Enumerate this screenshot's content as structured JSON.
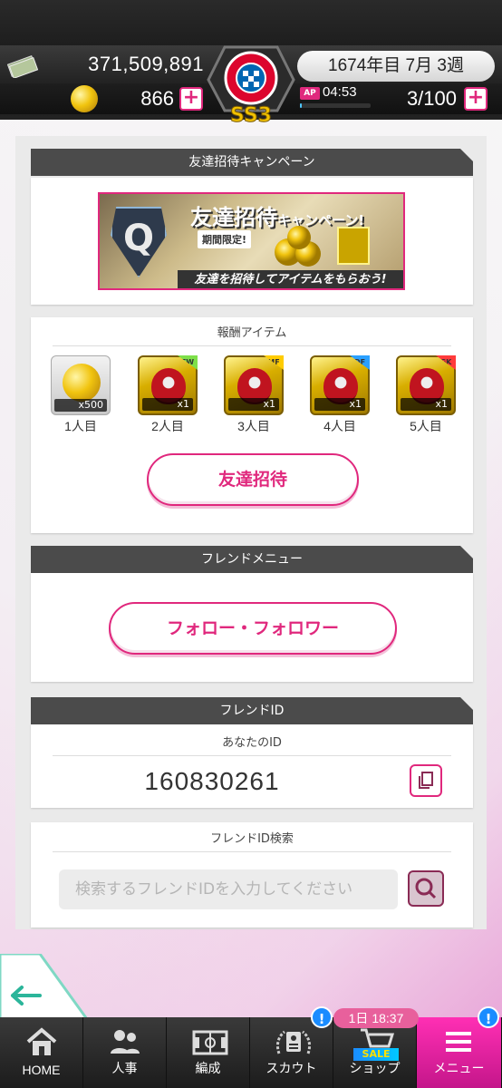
{
  "header": {
    "money": "371,509,891",
    "coins": "866",
    "date": "1674年目 7月 3週",
    "ap_label": "AP",
    "ap_time": "04:53",
    "ap_count": "3/100",
    "ap_fill_fraction": 0.03,
    "club_emblem_text": "FC BAYERN MÜNCHEN",
    "rank_badge": "SS3"
  },
  "invite": {
    "title": "友達招待キャンペーン",
    "banner": {
      "title_main": "友達招待",
      "title_sub": "キャンペーン!",
      "limited": "期間限定!",
      "slogan": "友達を招待してアイテムをもらおう!",
      "badge_letter": "Q"
    },
    "rewards_title": "報酬アイテム",
    "rewards": [
      {
        "qty": "x500",
        "label": "1人目",
        "type": "gold-ball"
      },
      {
        "qty": "x1",
        "label": "2人目",
        "type": "card",
        "pos": "FW",
        "pos_color": "#7ee04a"
      },
      {
        "qty": "x1",
        "label": "3人目",
        "type": "card",
        "pos": "MF",
        "pos_color": "#ffcc00"
      },
      {
        "qty": "x1",
        "label": "4人目",
        "type": "card",
        "pos": "DF",
        "pos_color": "#2aa0ff"
      },
      {
        "qty": "x1",
        "label": "5人目",
        "type": "card",
        "pos": "GK",
        "pos_color": "#ff3b3b"
      }
    ],
    "invite_button": "友達招待"
  },
  "friend_menu": {
    "title": "フレンドメニュー",
    "follow_button": "フォロー・フォロワー"
  },
  "friend_id": {
    "title": "フレンドID",
    "your_id_label": "あなたのID",
    "your_id": "160830261"
  },
  "friend_search": {
    "title": "フレンドID検索",
    "placeholder": "検索するフレンドIDを入力してください"
  },
  "nav": {
    "items": [
      {
        "label": "HOME",
        "icon": "home-icon"
      },
      {
        "label": "人事",
        "icon": "people-icon"
      },
      {
        "label": "編成",
        "icon": "field-icon"
      },
      {
        "label": "スカウト",
        "icon": "scout-icon",
        "badge": "!"
      },
      {
        "label": "ショップ",
        "icon": "cart-icon",
        "timer": "1日 18:37",
        "tag": "SALE"
      },
      {
        "label": "メニュー",
        "icon": "menu-icon",
        "badge": "!"
      }
    ]
  },
  "colors": {
    "accent": "#e0287d",
    "header_bg": "#4b4b4b",
    "badge_blue": "#1a8cff"
  }
}
